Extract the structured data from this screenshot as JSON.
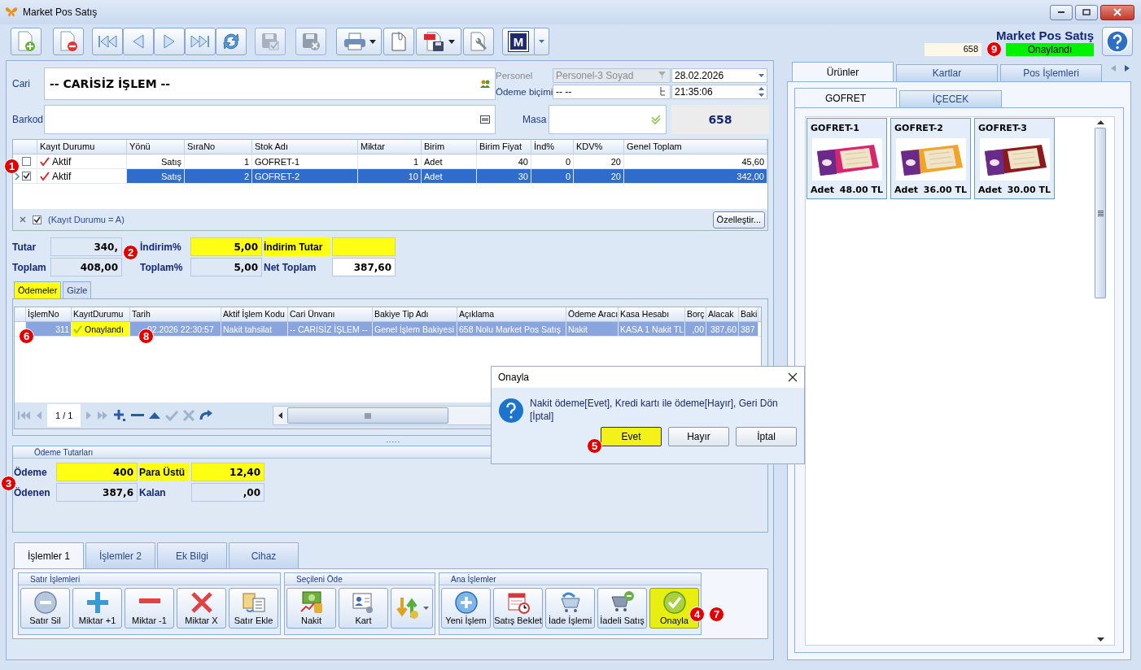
{
  "window": {
    "title": "Market Pos Satış"
  },
  "toolbar": {
    "app_label": "M"
  },
  "header": {
    "title": "Market Pos Satış",
    "number": "658",
    "status": "Onaylandı"
  },
  "form": {
    "cari_label": "Cari",
    "cari_value": "-- CARİSİZ İŞLEM --",
    "personel_label": "Personel",
    "personel_value": "Personel-3 Soyad",
    "date": "28.02.2026",
    "odeme_label": "Ödeme biçimi",
    "odeme_value": "-- --",
    "time": "21:35:06",
    "barkod_label": "Barkod",
    "masa_label": "Masa",
    "masa_number": "658"
  },
  "lines": {
    "columns": [
      "Kayıt Durumu",
      "Yönü",
      "SıraNo",
      "Stok Adı",
      "Miktar",
      "Birim",
      "Birim Fiyat",
      "İnd%",
      "KDV%",
      "Genel Toplam"
    ],
    "rows": [
      {
        "checked": false,
        "selected": false,
        "cells": [
          "Aktif",
          "Satış",
          "1",
          "GOFRET-1",
          "1",
          "Adet",
          "40",
          "0",
          "20",
          "45,60"
        ]
      },
      {
        "checked": true,
        "selected": true,
        "cells": [
          "Aktif",
          "Satış",
          "2",
          "GOFRET-2",
          "10",
          "Adet",
          "30",
          "0",
          "20",
          "342,00"
        ]
      }
    ],
    "filter": {
      "checked": true,
      "text": "(Kayıt Durumu = A)"
    },
    "customize_button": "Özelleştir..."
  },
  "totals": [
    {
      "label": "Tutar",
      "value": "340,",
      "label_highlighted": false,
      "value_highlighted": false,
      "readonly": true
    },
    {
      "label": "İndirim%",
      "value": "5,00",
      "label_highlighted": false,
      "value_highlighted": true,
      "readonly": false
    },
    {
      "label": "İndirim Tutar",
      "label_highlighted": true,
      "value_highlighted": true,
      "readonly": false
    },
    {
      "label": "Toplam",
      "value": "408,00",
      "label_highlighted": false,
      "value_highlighted": false,
      "readonly": true
    },
    {
      "label": "Toplam%",
      "value": "5,00",
      "label_highlighted": false,
      "value_highlighted": false,
      "readonly": true
    },
    {
      "label": "Net Toplam",
      "value": "387,60",
      "label_highlighted": false,
      "value_highlighted": false,
      "readonly": false
    }
  ],
  "payments": {
    "tabs": [
      {
        "label": "Ödemeler",
        "selected": true
      },
      {
        "label": "Gizle",
        "selected": false
      }
    ],
    "columns": [
      "İşlemNo",
      "KayıtDurumu",
      "Tarih",
      "Aktif İşlem Kodu",
      "Cari Ünvanı",
      "Bakiye Tip Adı",
      "Açıklama",
      "Ödeme Aracı",
      "Kasa Hesabı",
      "Borç",
      "Alacak",
      "Baki"
    ],
    "rows": [
      {
        "selected": true,
        "status_highlighted": true,
        "cells": [
          "311",
          "Onaylandı",
          "02.2026 22:30:57",
          "Nakit tahsilat",
          "-- CARİSİZ İŞLEM --",
          "Genel İşlem Bakiyesi",
          "658 Nolu Market Pos Satış",
          "Nakit",
          "KASA 1 Nakit TL",
          ",00",
          "387,60",
          "387"
        ]
      }
    ],
    "page": "1 / 1"
  },
  "payment_totals": {
    "title": "Ödeme Tutarları",
    "fields": [
      {
        "label": "Ödeme",
        "value": "400",
        "label_highlighted": false,
        "value_highlighted": true,
        "readonly": false
      },
      {
        "label": "Para Üstü",
        "value": "12,40",
        "label_highlighted": true,
        "value_highlighted": true,
        "readonly": true
      },
      {
        "label": "Ödenen",
        "value": "387,6",
        "label_highlighted": false,
        "value_highlighted": false,
        "readonly": true
      },
      {
        "label": "Kalan",
        "value": ",00",
        "label_highlighted": false,
        "value_highlighted": false,
        "readonly": true
      }
    ]
  },
  "bottom_tabs": [
    {
      "label": "İşlemler 1",
      "selected": true
    },
    {
      "label": "İşlemler 2",
      "selected": false
    },
    {
      "label": "Ek Bilgi",
      "selected": false
    },
    {
      "label": "Cihaz",
      "selected": false
    }
  ],
  "groups": [
    {
      "title": "Satır İşlemleri",
      "buttons": [
        {
          "kind": "remove",
          "label": "Satır Sil",
          "highlighted": false
        },
        {
          "kind": "plus",
          "label": "Miktar +1",
          "highlighted": false
        },
        {
          "kind": "minus",
          "label": "Miktar -1",
          "highlighted": false
        },
        {
          "kind": "cross",
          "label": "Miktar X",
          "highlighted": false
        },
        {
          "kind": "add-row",
          "label": "Satır Ekle",
          "highlighted": false
        }
      ]
    },
    {
      "title": "Seçileni Öde",
      "buttons": [
        {
          "kind": "cash",
          "label": "Nakit",
          "highlighted": false
        },
        {
          "kind": "card",
          "label": "Kart",
          "highlighted": false
        },
        {
          "kind": "exchange",
          "highlighted": false
        }
      ]
    },
    {
      "title": "Ana İşlemler",
      "buttons": [
        {
          "kind": "new",
          "label": "Yeni İşlem",
          "highlighted": false
        },
        {
          "kind": "calendar",
          "label": "Satış Beklet",
          "highlighted": false
        },
        {
          "kind": "return",
          "label": "İade İşlemi",
          "highlighted": false
        },
        {
          "kind": "return-sale",
          "label": "İadeli Satış",
          "highlighted": false
        },
        {
          "kind": "confirm",
          "label": "Onayla",
          "highlighted": true
        }
      ]
    }
  ],
  "right": {
    "tabs": [
      {
        "label": "Ürünler",
        "selected": true
      },
      {
        "label": "Kartlar",
        "selected": false
      },
      {
        "label": "Pos İşlemleri",
        "selected": false
      }
    ],
    "subtabs": [
      {
        "label": "GOFRET",
        "selected": true
      },
      {
        "label": "İÇECEK",
        "selected": false
      }
    ],
    "products": [
      {
        "name": "GOFRET-1",
        "unit": "Adet",
        "price": "48.00 TL"
      },
      {
        "name": "GOFRET-2",
        "unit": "Adet",
        "price": "36.00 TL"
      },
      {
        "name": "GOFRET-3",
        "unit": "Adet",
        "price": "30.00 TL"
      }
    ]
  },
  "dialog": {
    "title": "Onayla",
    "message": "Nakit ödeme[Evet], Kredi kartı ile ödeme[Hayır], Geri Dön [İptal]",
    "buttons": [
      {
        "label": "Evet",
        "highlighted": true
      },
      {
        "label": "Hayır",
        "highlighted": false
      },
      {
        "label": "İptal",
        "highlighted": false
      }
    ]
  },
  "annotations": [
    {
      "label": "9"
    },
    {
      "label": "1"
    },
    {
      "label": "2"
    },
    {
      "label": "6"
    },
    {
      "label": "8"
    },
    {
      "label": "5"
    },
    {
      "label": "3"
    },
    {
      "label": "4"
    },
    {
      "label": "7"
    }
  ]
}
